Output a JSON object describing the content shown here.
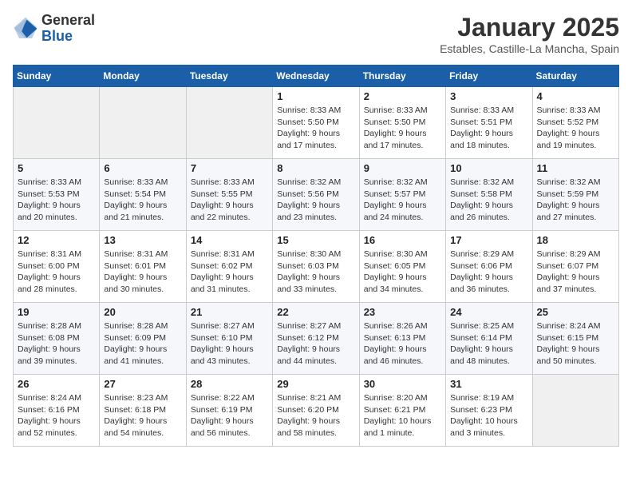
{
  "header": {
    "logo": {
      "general": "General",
      "blue": "Blue"
    },
    "title": "January 2025",
    "subtitle": "Estables, Castille-La Mancha, Spain"
  },
  "weekdays": [
    "Sunday",
    "Monday",
    "Tuesday",
    "Wednesday",
    "Thursday",
    "Friday",
    "Saturday"
  ],
  "weeks": [
    [
      {
        "day": "",
        "sunrise": "",
        "sunset": "",
        "daylight": ""
      },
      {
        "day": "",
        "sunrise": "",
        "sunset": "",
        "daylight": ""
      },
      {
        "day": "",
        "sunrise": "",
        "sunset": "",
        "daylight": ""
      },
      {
        "day": "1",
        "sunrise": "Sunrise: 8:33 AM",
        "sunset": "Sunset: 5:50 PM",
        "daylight": "Daylight: 9 hours and 17 minutes."
      },
      {
        "day": "2",
        "sunrise": "Sunrise: 8:33 AM",
        "sunset": "Sunset: 5:50 PM",
        "daylight": "Daylight: 9 hours and 17 minutes."
      },
      {
        "day": "3",
        "sunrise": "Sunrise: 8:33 AM",
        "sunset": "Sunset: 5:51 PM",
        "daylight": "Daylight: 9 hours and 18 minutes."
      },
      {
        "day": "4",
        "sunrise": "Sunrise: 8:33 AM",
        "sunset": "Sunset: 5:52 PM",
        "daylight": "Daylight: 9 hours and 19 minutes."
      }
    ],
    [
      {
        "day": "5",
        "sunrise": "Sunrise: 8:33 AM",
        "sunset": "Sunset: 5:53 PM",
        "daylight": "Daylight: 9 hours and 20 minutes."
      },
      {
        "day": "6",
        "sunrise": "Sunrise: 8:33 AM",
        "sunset": "Sunset: 5:54 PM",
        "daylight": "Daylight: 9 hours and 21 minutes."
      },
      {
        "day": "7",
        "sunrise": "Sunrise: 8:33 AM",
        "sunset": "Sunset: 5:55 PM",
        "daylight": "Daylight: 9 hours and 22 minutes."
      },
      {
        "day": "8",
        "sunrise": "Sunrise: 8:32 AM",
        "sunset": "Sunset: 5:56 PM",
        "daylight": "Daylight: 9 hours and 23 minutes."
      },
      {
        "day": "9",
        "sunrise": "Sunrise: 8:32 AM",
        "sunset": "Sunset: 5:57 PM",
        "daylight": "Daylight: 9 hours and 24 minutes."
      },
      {
        "day": "10",
        "sunrise": "Sunrise: 8:32 AM",
        "sunset": "Sunset: 5:58 PM",
        "daylight": "Daylight: 9 hours and 26 minutes."
      },
      {
        "day": "11",
        "sunrise": "Sunrise: 8:32 AM",
        "sunset": "Sunset: 5:59 PM",
        "daylight": "Daylight: 9 hours and 27 minutes."
      }
    ],
    [
      {
        "day": "12",
        "sunrise": "Sunrise: 8:31 AM",
        "sunset": "Sunset: 6:00 PM",
        "daylight": "Daylight: 9 hours and 28 minutes."
      },
      {
        "day": "13",
        "sunrise": "Sunrise: 8:31 AM",
        "sunset": "Sunset: 6:01 PM",
        "daylight": "Daylight: 9 hours and 30 minutes."
      },
      {
        "day": "14",
        "sunrise": "Sunrise: 8:31 AM",
        "sunset": "Sunset: 6:02 PM",
        "daylight": "Daylight: 9 hours and 31 minutes."
      },
      {
        "day": "15",
        "sunrise": "Sunrise: 8:30 AM",
        "sunset": "Sunset: 6:03 PM",
        "daylight": "Daylight: 9 hours and 33 minutes."
      },
      {
        "day": "16",
        "sunrise": "Sunrise: 8:30 AM",
        "sunset": "Sunset: 6:05 PM",
        "daylight": "Daylight: 9 hours and 34 minutes."
      },
      {
        "day": "17",
        "sunrise": "Sunrise: 8:29 AM",
        "sunset": "Sunset: 6:06 PM",
        "daylight": "Daylight: 9 hours and 36 minutes."
      },
      {
        "day": "18",
        "sunrise": "Sunrise: 8:29 AM",
        "sunset": "Sunset: 6:07 PM",
        "daylight": "Daylight: 9 hours and 37 minutes."
      }
    ],
    [
      {
        "day": "19",
        "sunrise": "Sunrise: 8:28 AM",
        "sunset": "Sunset: 6:08 PM",
        "daylight": "Daylight: 9 hours and 39 minutes."
      },
      {
        "day": "20",
        "sunrise": "Sunrise: 8:28 AM",
        "sunset": "Sunset: 6:09 PM",
        "daylight": "Daylight: 9 hours and 41 minutes."
      },
      {
        "day": "21",
        "sunrise": "Sunrise: 8:27 AM",
        "sunset": "Sunset: 6:10 PM",
        "daylight": "Daylight: 9 hours and 43 minutes."
      },
      {
        "day": "22",
        "sunrise": "Sunrise: 8:27 AM",
        "sunset": "Sunset: 6:12 PM",
        "daylight": "Daylight: 9 hours and 44 minutes."
      },
      {
        "day": "23",
        "sunrise": "Sunrise: 8:26 AM",
        "sunset": "Sunset: 6:13 PM",
        "daylight": "Daylight: 9 hours and 46 minutes."
      },
      {
        "day": "24",
        "sunrise": "Sunrise: 8:25 AM",
        "sunset": "Sunset: 6:14 PM",
        "daylight": "Daylight: 9 hours and 48 minutes."
      },
      {
        "day": "25",
        "sunrise": "Sunrise: 8:24 AM",
        "sunset": "Sunset: 6:15 PM",
        "daylight": "Daylight: 9 hours and 50 minutes."
      }
    ],
    [
      {
        "day": "26",
        "sunrise": "Sunrise: 8:24 AM",
        "sunset": "Sunset: 6:16 PM",
        "daylight": "Daylight: 9 hours and 52 minutes."
      },
      {
        "day": "27",
        "sunrise": "Sunrise: 8:23 AM",
        "sunset": "Sunset: 6:18 PM",
        "daylight": "Daylight: 9 hours and 54 minutes."
      },
      {
        "day": "28",
        "sunrise": "Sunrise: 8:22 AM",
        "sunset": "Sunset: 6:19 PM",
        "daylight": "Daylight: 9 hours and 56 minutes."
      },
      {
        "day": "29",
        "sunrise": "Sunrise: 8:21 AM",
        "sunset": "Sunset: 6:20 PM",
        "daylight": "Daylight: 9 hours and 58 minutes."
      },
      {
        "day": "30",
        "sunrise": "Sunrise: 8:20 AM",
        "sunset": "Sunset: 6:21 PM",
        "daylight": "Daylight: 10 hours and 1 minute."
      },
      {
        "day": "31",
        "sunrise": "Sunrise: 8:19 AM",
        "sunset": "Sunset: 6:23 PM",
        "daylight": "Daylight: 10 hours and 3 minutes."
      },
      {
        "day": "",
        "sunrise": "",
        "sunset": "",
        "daylight": ""
      }
    ]
  ]
}
